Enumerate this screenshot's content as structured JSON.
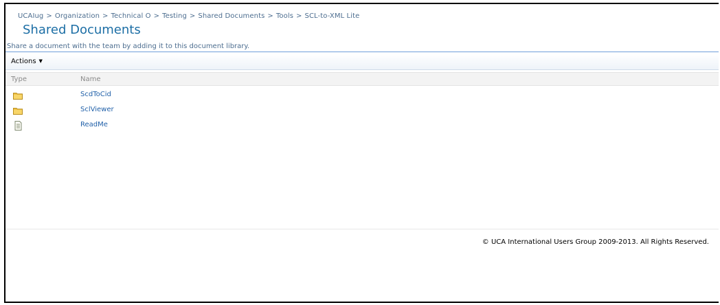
{
  "breadcrumb": {
    "items": [
      "UCAIug",
      "Organization",
      "Technical O",
      "Testing",
      "Shared Documents",
      "Tools",
      "SCL-to-XML Lite"
    ],
    "separator": ">"
  },
  "page": {
    "title": "Shared Documents",
    "description": "Share a document with the team by adding it to this document library."
  },
  "toolbar": {
    "actions_label": "Actions"
  },
  "table": {
    "columns": [
      "Type",
      "Name"
    ],
    "rows": [
      {
        "type_icon": "folder-icon",
        "name": "ScdToCid"
      },
      {
        "type_icon": "folder-icon",
        "name": "SclViewer"
      },
      {
        "type_icon": "text-document-icon",
        "name": "ReadMe"
      }
    ]
  },
  "footer": {
    "copyright": "© UCA International Users Group 2009-2013. All Rights Reserved."
  },
  "colors": {
    "title": "#1c6ea5",
    "link": "#1f5fa8",
    "breadcrumb": "#4c6d8f",
    "folder": "#f0c24a"
  }
}
